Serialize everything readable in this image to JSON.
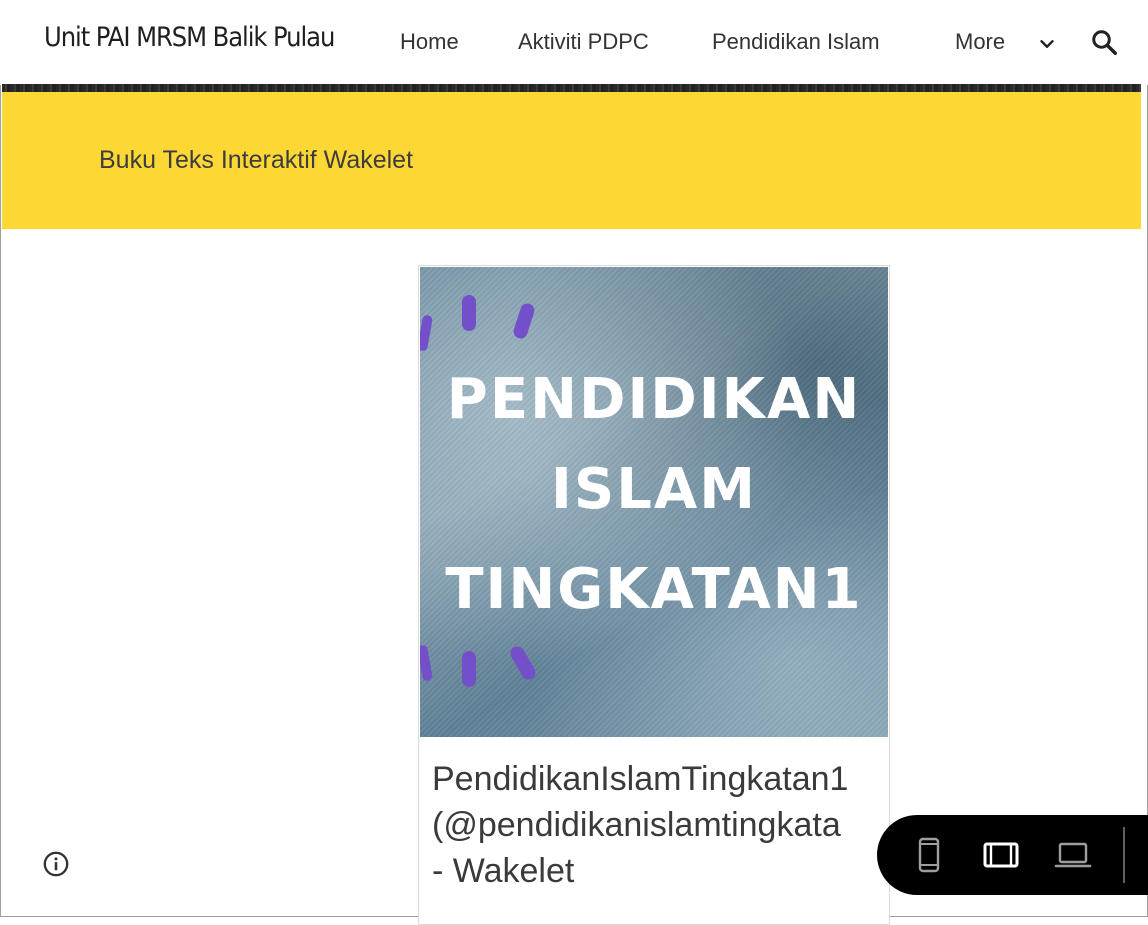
{
  "header": {
    "site_title": "Unit PAI MRSM Balik Pulau",
    "nav": {
      "home": "Home",
      "aktiviti": "Aktiviti PDPC",
      "pendidikan": "Pendidikan Islam",
      "more": "More"
    },
    "icons": {
      "more": "chevron-down-icon",
      "search": "search-icon"
    }
  },
  "banner": {
    "title": "Buku Teks Interaktif Wakelet",
    "color": "#fdd835"
  },
  "card": {
    "image": {
      "line1": "PENDIDIKAN",
      "line2": "ISLAM",
      "line3": "TINGKATAN1",
      "accent_color": "#7350c9"
    },
    "title_line1": "PendidikanIslamTingkatan1",
    "title_line2": "(@pendidikanislamtingkata",
    "title_line3": "- Wakelet"
  },
  "footer": {
    "info_icon": "info-icon"
  },
  "preview_toolbar": {
    "icons": [
      "phone-icon",
      "tablet-icon",
      "laptop-icon"
    ],
    "selected": "tablet-icon"
  }
}
